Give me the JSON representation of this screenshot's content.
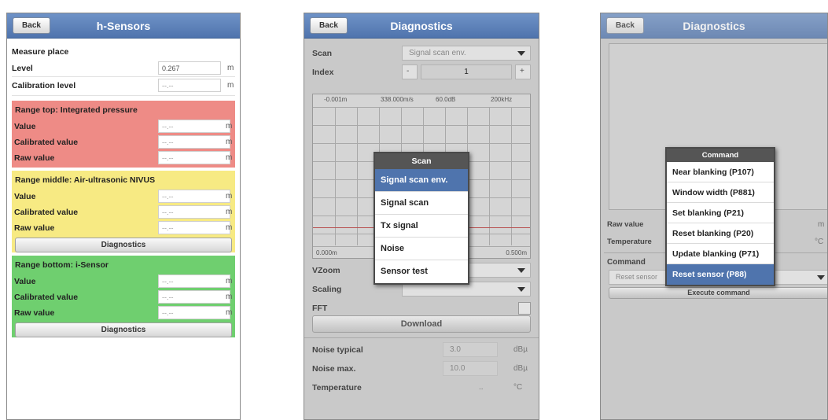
{
  "screen1": {
    "back": "Back",
    "title": "h-Sensors",
    "measure_place": "Measure place",
    "level_label": "Level",
    "level_value": "0.267",
    "level_unit": "m",
    "calib_label": "Calibration level",
    "calib_value": "--.--",
    "calib_unit": "m",
    "sections": [
      {
        "title": "Range top: Integrated pressure",
        "color": "#ee8b86",
        "rows": [
          {
            "label": "Value",
            "value": "--.--",
            "unit": "m"
          },
          {
            "label": "Calibrated value",
            "value": "--.--",
            "unit": "m"
          },
          {
            "label": "Raw value",
            "value": "--.--",
            "unit": "m"
          }
        ],
        "button": ""
      },
      {
        "title": "Range middle: Air-ultrasonic NIVUS",
        "color": "#f7ea83",
        "rows": [
          {
            "label": "Value",
            "value": "--.--",
            "unit": "m"
          },
          {
            "label": "Calibrated value",
            "value": "--.--",
            "unit": "m"
          },
          {
            "label": "Raw value",
            "value": "--.--",
            "unit": "m"
          }
        ],
        "button": "Diagnostics"
      },
      {
        "title": "Range bottom: i-Sensor",
        "color": "#6fcf6f",
        "rows": [
          {
            "label": "Value",
            "value": "--.--",
            "unit": "m"
          },
          {
            "label": "Calibrated value",
            "value": "--.--",
            "unit": "m"
          },
          {
            "label": "Raw value",
            "value": "--.--",
            "unit": "m"
          }
        ],
        "button": "Diagnostics"
      }
    ]
  },
  "screen2": {
    "back": "Back",
    "title": "Diagnostics",
    "scan_label": "Scan",
    "scan_value": "Signal scan env.",
    "index_label": "Index",
    "index_value": "1",
    "minus": "-",
    "plus": "+",
    "chart_top": [
      "-0.001m",
      "338.000m/s",
      "60.0dB",
      "200kHz"
    ],
    "chart_bottom_left": "0.000m",
    "chart_bottom_right": "0.500m",
    "vzoom_label": "VZoom",
    "scaling_label": "Scaling",
    "fft_label": "FFT",
    "download": "Download",
    "noise_typ_label": "Noise typical",
    "noise_typ_value": "3.0",
    "noise_typ_unit": "dBµ",
    "noise_max_label": "Noise max.",
    "noise_max_value": "10.0",
    "noise_max_unit": "dBµ",
    "temp_label": "Temperature",
    "temp_value": "..",
    "temp_unit": "°C",
    "popup": {
      "title": "Scan",
      "items": [
        "Signal scan env.",
        "Signal scan",
        "Tx signal",
        "Noise",
        "Sensor test"
      ]
    }
  },
  "screen3": {
    "back": "Back",
    "title": "Diagnostics",
    "raw_label": "Raw value",
    "raw_unit": "m",
    "temp_label": "Temperature",
    "temp_unit": "°C",
    "command_label": "Command",
    "command_value": "Reset sensor",
    "execute": "Execute command",
    "popup": {
      "title": "Command",
      "items": [
        "Near blanking (P107)",
        "Window width (P881)",
        "Set blanking (P21)",
        "Reset blanking (P20)",
        "Update blanking (P71)",
        "Reset sensor (P88)"
      ]
    }
  }
}
